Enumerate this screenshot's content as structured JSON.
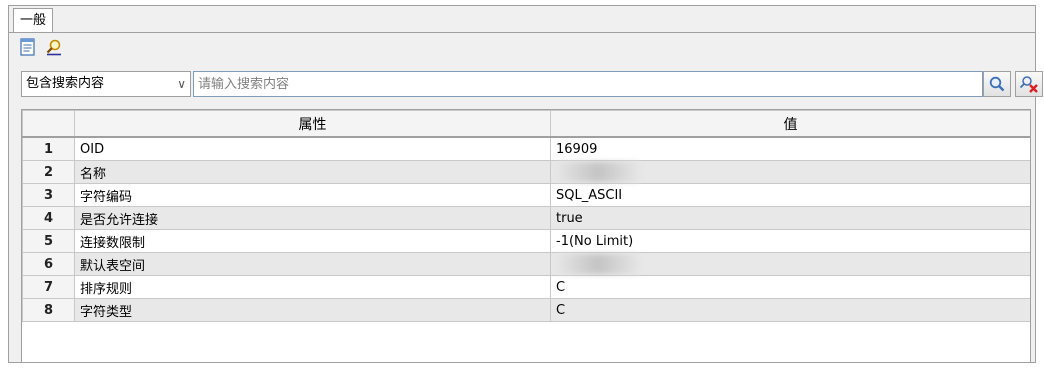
{
  "tab": {
    "label": "一般"
  },
  "toolbar": {
    "icons": [
      "document-icon",
      "find-icon"
    ]
  },
  "search": {
    "scope": "包含搜索内容",
    "placeholder": "请输入搜索内容"
  },
  "grid": {
    "headers": [
      "属性",
      "值"
    ],
    "rows": [
      {
        "num": "1",
        "prop": "OID",
        "value": "16909"
      },
      {
        "num": "2",
        "prop": "名称",
        "value": ""
      },
      {
        "num": "3",
        "prop": "字符编码",
        "value": "SQL_ASCII"
      },
      {
        "num": "4",
        "prop": "是否允许连接",
        "value": "true"
      },
      {
        "num": "5",
        "prop": "连接数限制",
        "value": "-1(No Limit)"
      },
      {
        "num": "6",
        "prop": "默认表空间",
        "value": ""
      },
      {
        "num": "7",
        "prop": "排序规则",
        "value": "C"
      },
      {
        "num": "8",
        "prop": "字符类型",
        "value": "C"
      }
    ]
  }
}
